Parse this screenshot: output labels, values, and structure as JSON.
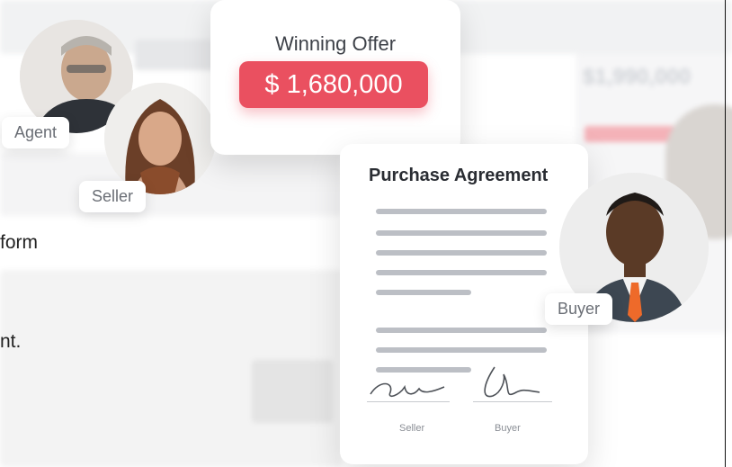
{
  "background": {
    "side_text_line1": "form",
    "side_text_line2": "nt.",
    "blurred_price": "$1,990,000"
  },
  "avatars": {
    "agent": {
      "label": "Agent"
    },
    "seller": {
      "label": "Seller"
    },
    "buyer": {
      "label": "Buyer"
    }
  },
  "offer_card": {
    "title": "Winning Offer",
    "price": "$ 1,680,000"
  },
  "agreement_card": {
    "title": "Purchase Agreement",
    "signature_labels": {
      "seller": "Seller",
      "buyer": "Buyer"
    }
  },
  "colors": {
    "accent": "#ea5060",
    "text_dark": "#2a2d33",
    "line_gray": "#bcbfc5"
  }
}
